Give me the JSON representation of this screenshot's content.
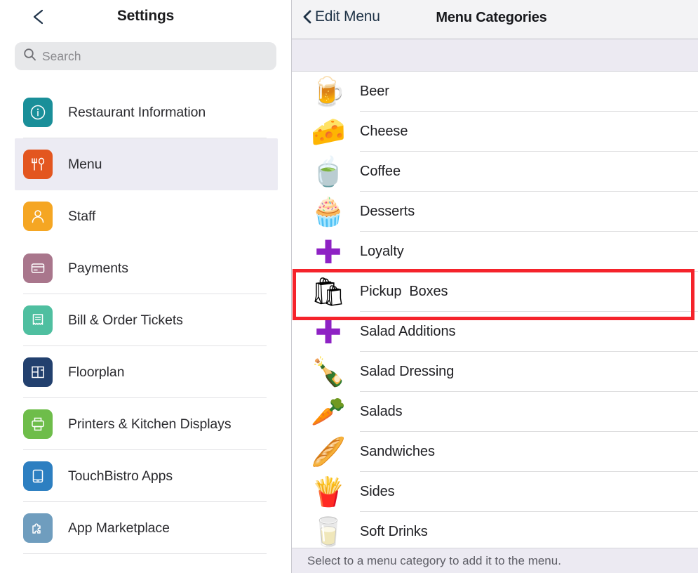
{
  "sidebar": {
    "back_icon": "chevron-left-icon",
    "title": "Settings",
    "search": {
      "icon": "search-icon",
      "placeholder": "Search",
      "value": ""
    },
    "items": [
      {
        "label": "Restaurant Information",
        "icon": "info-circle-icon",
        "color": "#1a8f99",
        "selected": false
      },
      {
        "label": "Menu",
        "icon": "fork-spoon-icon",
        "color": "#e3561f",
        "selected": true
      },
      {
        "label": "Staff",
        "icon": "person-icon",
        "color": "#f5a623",
        "selected": false
      },
      {
        "label": "Payments",
        "icon": "credit-card-icon",
        "color": "#a9768c",
        "selected": false
      },
      {
        "label": "Bill & Order Tickets",
        "icon": "receipt-icon",
        "color": "#4fbfa0",
        "selected": false
      },
      {
        "label": "Floorplan",
        "icon": "floorplan-icon",
        "color": "#22406e",
        "selected": false
      },
      {
        "label": "Printers & Kitchen Displays",
        "icon": "printer-icon",
        "color": "#6ebd4a",
        "selected": false
      },
      {
        "label": "TouchBistro Apps",
        "icon": "tablet-icon",
        "color": "#2d7fc1",
        "selected": false
      },
      {
        "label": "App Marketplace",
        "icon": "puzzle-piece-icon",
        "color": "#6f9dbe",
        "selected": false
      }
    ]
  },
  "right_panel": {
    "back_button": {
      "icon": "chevron-left-icon",
      "label": "Edit Menu"
    },
    "title": "Menu Categories",
    "categories": [
      {
        "label": "Beer",
        "emoji": "🍺",
        "icon": "beer-mug-emoji"
      },
      {
        "label": "Cheese",
        "emoji": "🧀",
        "icon": "cheese-wedge-emoji"
      },
      {
        "label": "Coffee",
        "emoji": "🍵",
        "icon": "teacup-emoji"
      },
      {
        "label": "Desserts",
        "emoji": "🧁",
        "icon": "cupcake-emoji"
      },
      {
        "label": "Loyalty",
        "emoji": "✚",
        "icon": "purple-cross-icon"
      },
      {
        "label": "Pickup  Boxes",
        "emoji": "🛍",
        "icon": "shopping-bag-emoji",
        "highlighted": true
      },
      {
        "label": "Salad Additions",
        "emoji": "✚",
        "icon": "purple-cross-icon"
      },
      {
        "label": "Salad Dressing",
        "emoji": "🍾",
        "icon": "bottle-emoji"
      },
      {
        "label": "Salads",
        "emoji": "🥕",
        "icon": "carrot-emoji"
      },
      {
        "label": "Sandwiches",
        "emoji": "🥖",
        "icon": "baguette-emoji"
      },
      {
        "label": "Sides",
        "emoji": "🍟",
        "icon": "french-fries-emoji"
      },
      {
        "label": "Soft Drinks",
        "emoji": "🥛",
        "icon": "milk-bottle-emoji"
      }
    ],
    "footer_text": "Select to a menu category to add it to the menu."
  },
  "annotation": {
    "color": "#f5232b",
    "target": "Pickup  Boxes"
  }
}
